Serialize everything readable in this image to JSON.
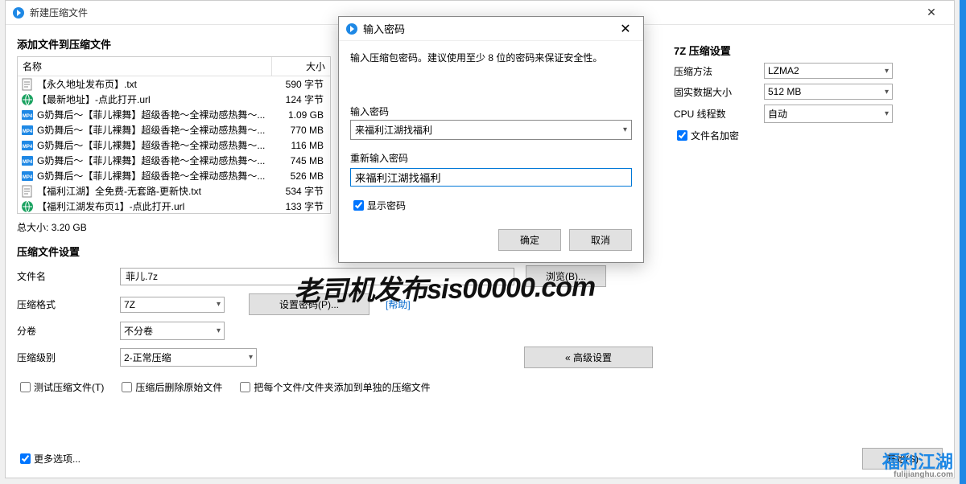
{
  "window": {
    "title": "新建压缩文件"
  },
  "section": {
    "add_label": "添加文件到压缩文件",
    "col_name": "名称",
    "col_size": "大小",
    "total_label": "总大小:",
    "total_value": "3.20 GB",
    "settings_label": "压缩文件设置",
    "sevenz_label": "7Z 压缩设置"
  },
  "files": [
    {
      "name": "【永久地址发布页】.txt",
      "size": "590 字节",
      "type": "txt"
    },
    {
      "name": "【最新地址】-点此打开.url",
      "size": "124 字节",
      "type": "url"
    },
    {
      "name": "G奶舞后～【菲儿裸舞】超级香艳～全裸动感热舞～...",
      "size": "1.09 GB",
      "type": "mp4"
    },
    {
      "name": "G奶舞后～【菲儿裸舞】超级香艳～全裸动感热舞～...",
      "size": "770 MB",
      "type": "mp4"
    },
    {
      "name": "G奶舞后～【菲儿裸舞】超级香艳～全裸动感热舞～...",
      "size": "116 MB",
      "type": "mp4"
    },
    {
      "name": "G奶舞后～【菲儿裸舞】超级香艳～全裸动感热舞～...",
      "size": "745 MB",
      "type": "mp4"
    },
    {
      "name": "G奶舞后～【菲儿裸舞】超级香艳～全裸动感热舞～...",
      "size": "526 MB",
      "type": "mp4"
    },
    {
      "name": "【福利江湖】全免费-无套路-更新快.txt",
      "size": "534 字节",
      "type": "txt"
    },
    {
      "name": "【福利江湖发布页1】-点此打开.url",
      "size": "133 字节",
      "type": "url"
    }
  ],
  "form": {
    "filename_label": "文件名",
    "filename_value": "菲儿.7z",
    "browse": "浏览(B)...",
    "format_label": "压缩格式",
    "format_value": "7Z",
    "set_password": "设置密码(P)...",
    "help": "[帮助]",
    "split_label": "分卷",
    "split_value": "不分卷",
    "level_label": "压缩级别",
    "level_value": "2-正常压缩",
    "advanced": "« 高级设置",
    "chk_test": "测试压缩文件(T)",
    "chk_delete": "压缩后删除原始文件",
    "chk_separate": "把每个文件/文件夹添加到单独的压缩文件",
    "more": "更多选项...",
    "start": "开始(S)"
  },
  "right": {
    "method_label": "压缩方法",
    "method_value": "LZMA2",
    "solid_label": "固实数据大小",
    "solid_value": "512 MB",
    "cpu_label": "CPU 线程数",
    "cpu_value": "自动",
    "encrypt_names": "文件名加密"
  },
  "dialog": {
    "title": "输入密码",
    "hint": "输入压缩包密码。建议使用至少 8 位的密码来保证安全性。",
    "pw_label": "输入密码",
    "pw_value": "来福利江湖找福利",
    "pw2_label": "重新输入密码",
    "pw2_value": "来福利江湖找福利",
    "show_pw": "显示密码",
    "ok": "确定",
    "cancel": "取消"
  },
  "watermark": {
    "text1": "老司机发布sis00000.com",
    "text2": "福利江湖",
    "text2_sub": "fulijianghu.com"
  }
}
